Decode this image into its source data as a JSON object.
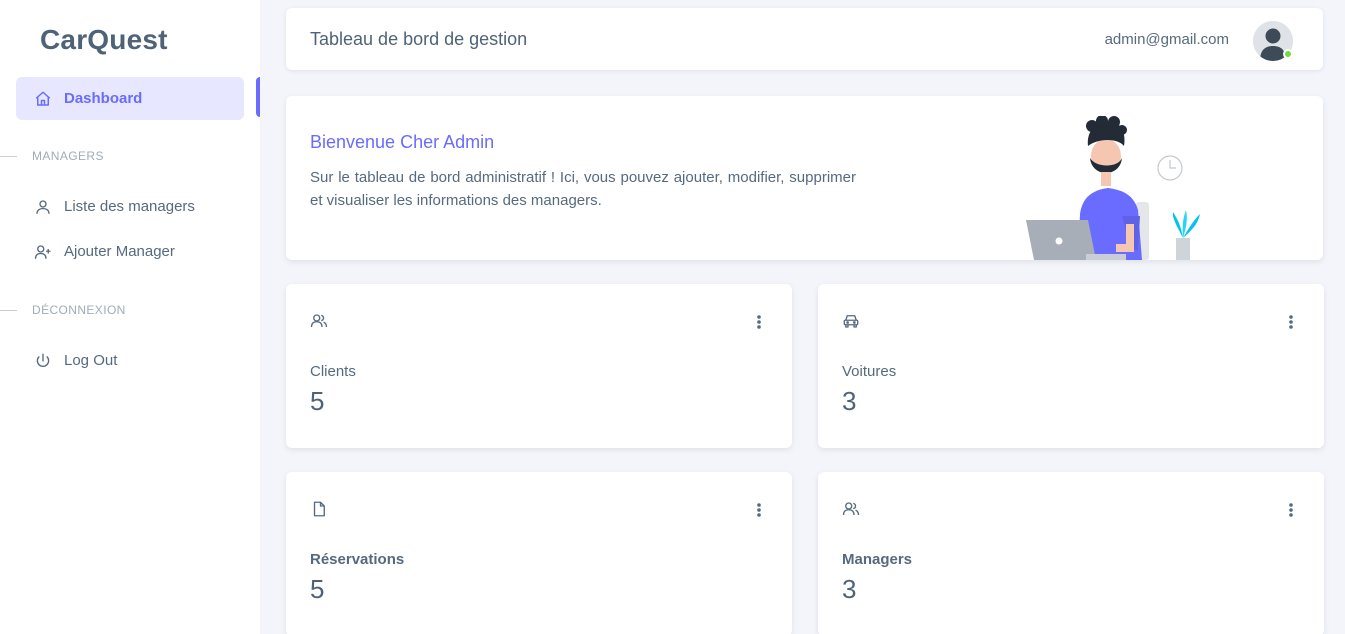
{
  "sidebar": {
    "brand": "CarQuest",
    "items": [
      {
        "label": "Dashboard",
        "icon": "home-icon",
        "active": true
      },
      {
        "label": "Liste des managers",
        "icon": "user-icon"
      },
      {
        "label": "Ajouter Manager",
        "icon": "user-plus-icon"
      },
      {
        "label": "Log Out",
        "icon": "power-icon"
      }
    ],
    "sections": [
      "MANAGERS",
      "DÉCONNEXION"
    ]
  },
  "topbar": {
    "title": "Tableau de bord de gestion",
    "email": "admin@gmail.com",
    "online_color": "#71dd37"
  },
  "welcome": {
    "title": "Bienvenue Cher Admin",
    "text": "Sur le tableau de bord administratif ! Ici, vous pouvez ajouter, modifier, supprimer et visualiser les informations des managers."
  },
  "stats": [
    {
      "label": "Clients",
      "value": "5",
      "icon": "users-icon"
    },
    {
      "label": "Voitures",
      "value": "3",
      "icon": "car-icon"
    },
    {
      "label": "Réservations",
      "value": "5",
      "icon": "file-icon"
    },
    {
      "label": "Managers",
      "value": "3",
      "icon": "users-icon"
    }
  ],
  "colors": {
    "accent": "#696cff",
    "accent_bg": "#e7e7ff",
    "text": "#566a7f",
    "heading": "#4f6378",
    "muted": "#a1acb8",
    "background": "#f4f5fa"
  }
}
